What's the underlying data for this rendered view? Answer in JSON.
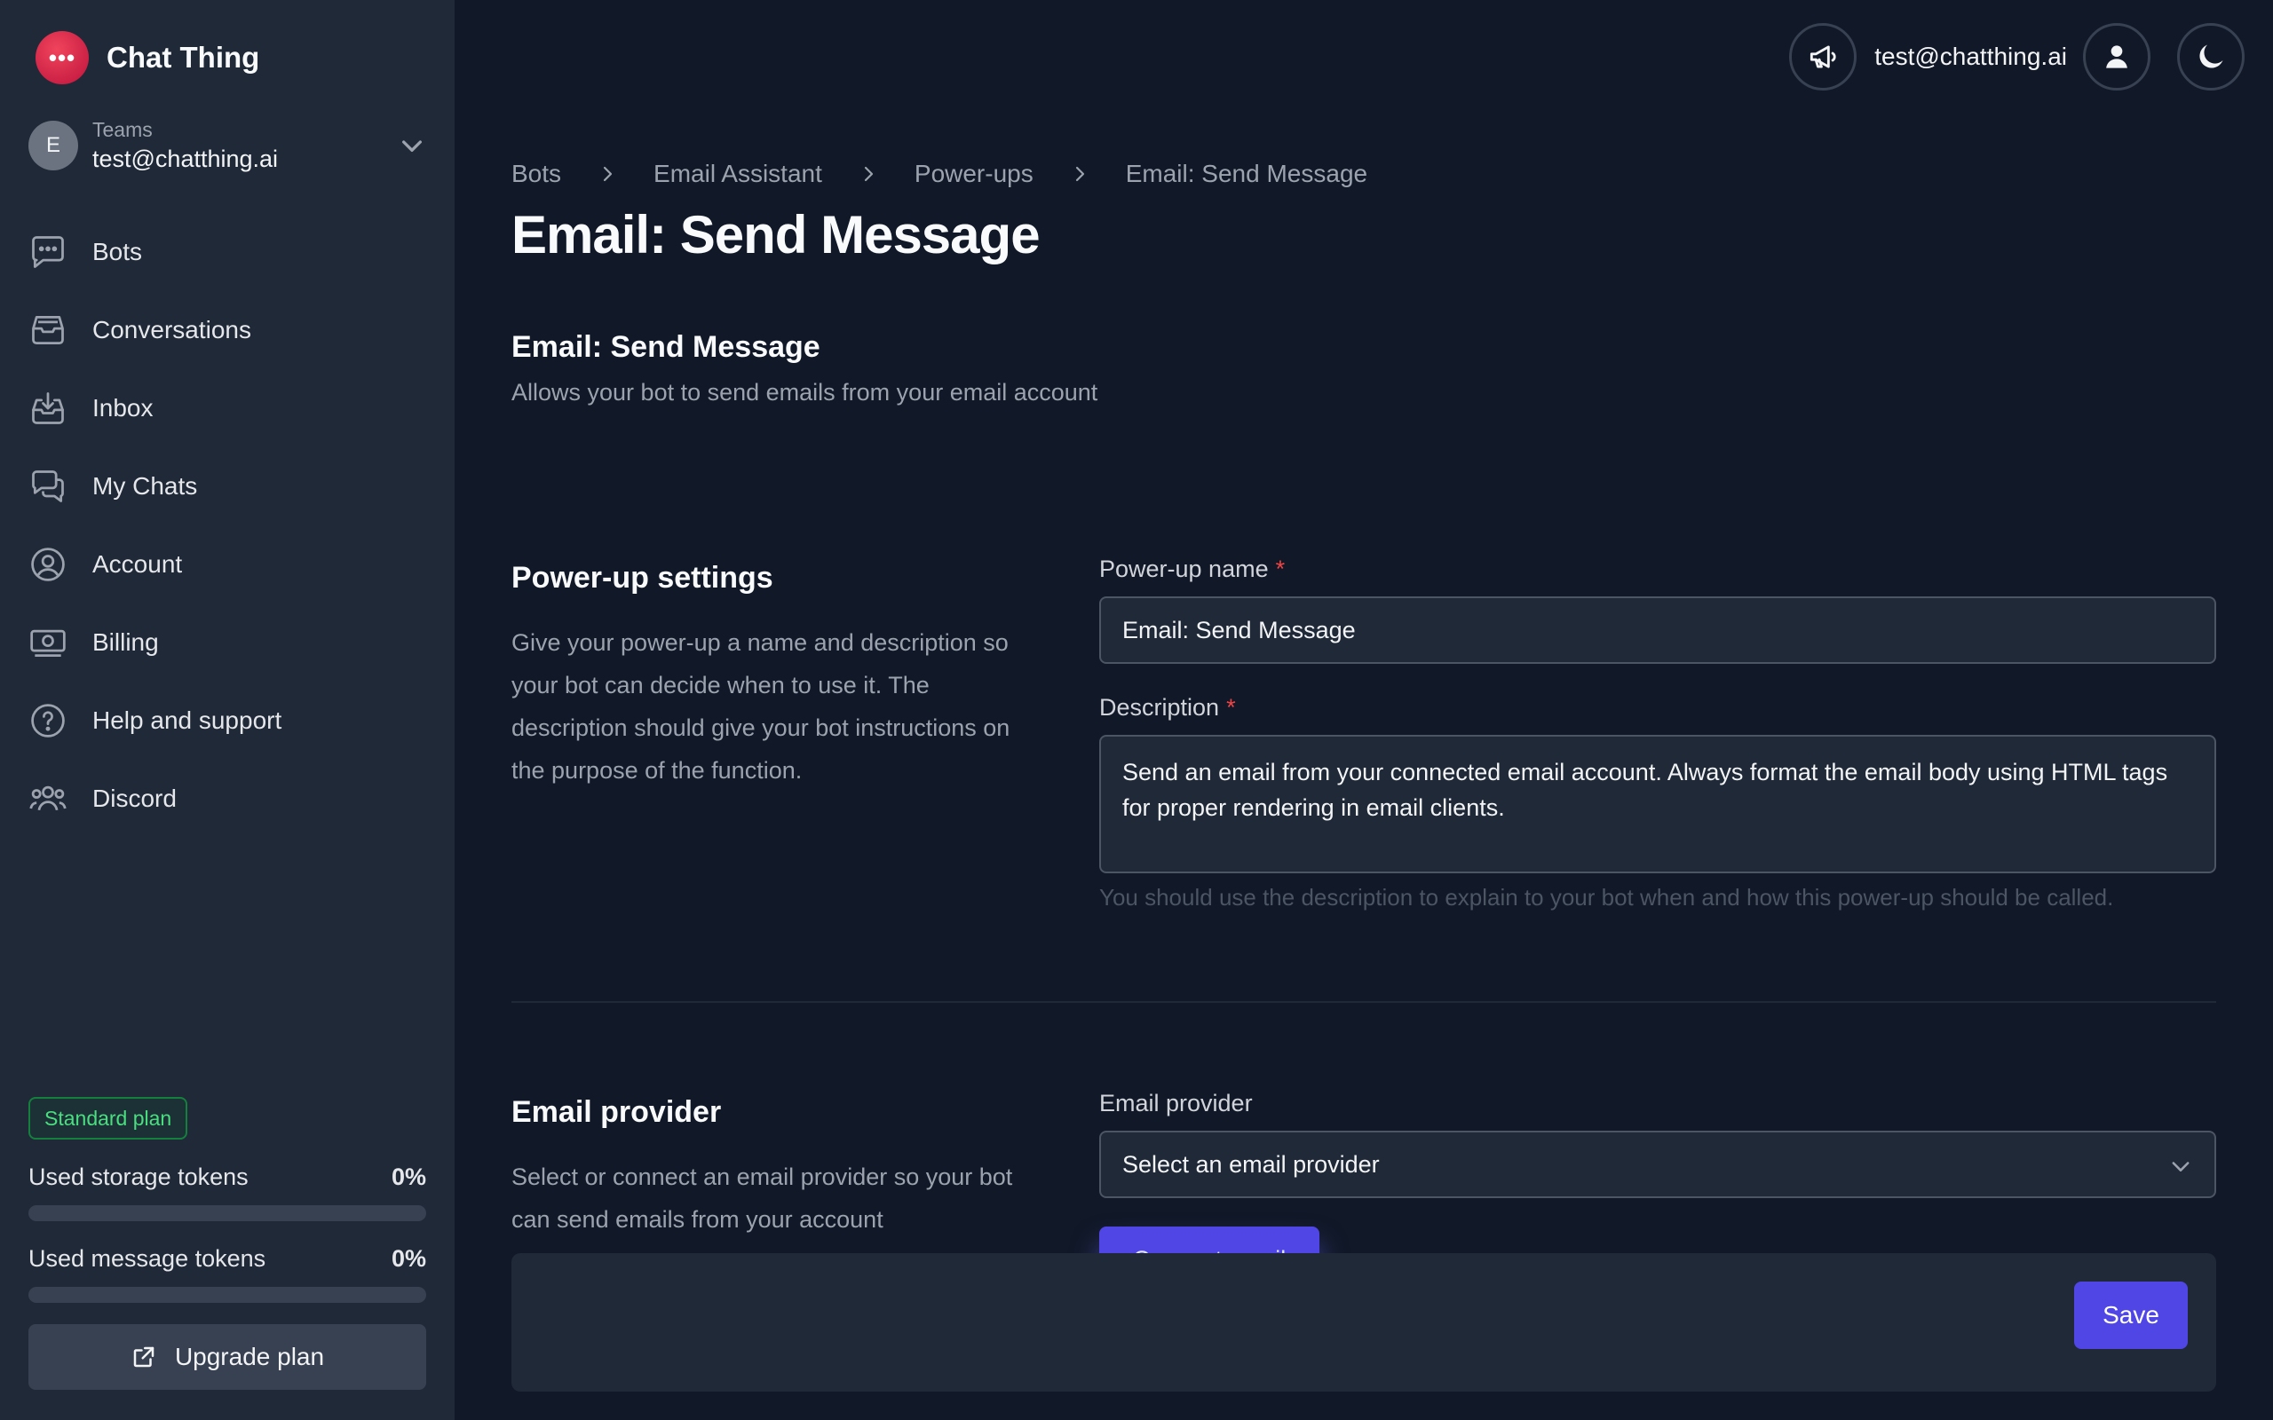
{
  "app": {
    "name": "Chat Thing",
    "accent": "#4f46e5",
    "brand_color": "#e11d48"
  },
  "team": {
    "avatar_initial": "E",
    "label": "Teams",
    "email": "test@chatthing.ai"
  },
  "nav": [
    {
      "label": "Bots",
      "icon": "chat-bubble-icon"
    },
    {
      "label": "Conversations",
      "icon": "inbox-stack-icon"
    },
    {
      "label": "Inbox",
      "icon": "inbox-download-icon"
    },
    {
      "label": "My Chats",
      "icon": "chat-bubbles-icon"
    },
    {
      "label": "Account",
      "icon": "user-circle-icon"
    },
    {
      "label": "Billing",
      "icon": "banknotes-icon"
    },
    {
      "label": "Help and support",
      "icon": "question-circle-icon"
    },
    {
      "label": "Discord",
      "icon": "user-group-icon"
    }
  ],
  "plan": {
    "badge": "Standard plan",
    "storage": {
      "label": "Used storage tokens",
      "value": "0%",
      "fraction": 0
    },
    "message": {
      "label": "Used message tokens",
      "value": "0%",
      "fraction": 0
    },
    "upgrade_label": "Upgrade plan"
  },
  "topbar": {
    "email": "test@chatthing.ai"
  },
  "breadcrumb": [
    "Bots",
    "Email Assistant",
    "Power-ups",
    "Email: Send Message"
  ],
  "page_title": "Email: Send Message",
  "header_section": {
    "title": "Email: Send Message",
    "description": "Allows your bot to send emails from your email account"
  },
  "settings": {
    "title": "Power-up settings",
    "description": "Give your power-up a name and description so your bot can decide when to use it. The description should give your bot instructions on the purpose of the function.",
    "name_label": "Power-up name",
    "name_value": "Email: Send Message",
    "required_mark": "*",
    "desc_label": "Description",
    "desc_value": "Send an email from your connected email account. Always format the email body using HTML tags for proper rendering in email clients.",
    "desc_help": "You should use the description to explain to your bot when and how this power-up should be called."
  },
  "provider": {
    "title": "Email provider",
    "description": "Select or connect an email provider so your bot can send emails from your account",
    "label": "Email provider",
    "select_value": "Select an email provider",
    "connect_label": "Connect email"
  },
  "save_label": "Save"
}
